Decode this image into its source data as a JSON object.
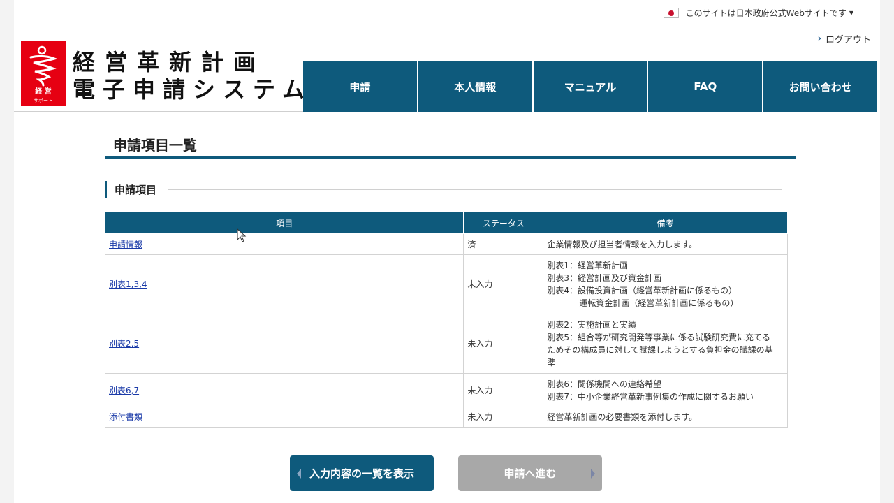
{
  "header": {
    "gov_notice": "このサイトは日本政府公式Webサイトです",
    "logout": "ログアウト",
    "logo_text_top": "経 営",
    "logo_text_bottom": "サポート",
    "site_title_line1": "経営革新計画",
    "site_title_line2": "電子申請システム"
  },
  "nav": {
    "items": [
      "申請",
      "本人情報",
      "マニュアル",
      "FAQ",
      "お問い合わせ"
    ]
  },
  "main": {
    "page_title": "申請項目一覧",
    "section_title": "申請項目",
    "table": {
      "headers": [
        "項目",
        "ステータス",
        "備考"
      ],
      "rows": [
        {
          "item": "申請情報",
          "status": "済",
          "notes": [
            "企業情報及び担当者情報を入力します。"
          ]
        },
        {
          "item": "別表1,3,4",
          "status": "未入力",
          "notes": [
            "別表1：経営革新計画",
            "別表3：経営計画及び資金計画",
            "別表4：設備投資計画（経営革新計画に係るもの）",
            "運転資金計画（経営革新計画に係るもの）"
          ]
        },
        {
          "item": "別表2,5",
          "status": "未入力",
          "notes": [
            "別表2：実施計画と実績",
            "別表5：組合等が研究開発等事業に係る試験研究費に充てる",
            "ためその構成員に対して賦課しようとする負担金の賦課の基",
            "準"
          ]
        },
        {
          "item": "別表6,7",
          "status": "未入力",
          "notes": [
            "別表6：関係機関への連絡希望",
            "別表7：中小企業経営革新事例集の作成に関するお願い"
          ]
        },
        {
          "item": "添付書類",
          "status": "未入力",
          "notes": [
            "経営革新計画の必要書類を添付します。"
          ]
        }
      ]
    }
  },
  "buttons": {
    "show_list": "入力内容の一覧を表示",
    "proceed": "申請へ進む"
  },
  "colors": {
    "primary": "#0e5a7c",
    "logo_red": "#e60012",
    "disabled": "#a8a8a8",
    "link": "#1a3aa8"
  }
}
